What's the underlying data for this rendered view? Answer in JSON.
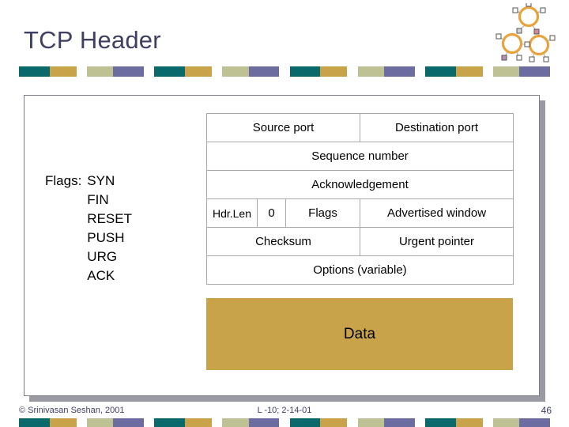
{
  "slide": {
    "title": "TCP Header",
    "title_color": "#3f3f63"
  },
  "logo": {
    "name": "molecule-logo",
    "ring_color": "#e8a33d",
    "node_color": "#ffffff"
  },
  "colorbar": {
    "colors": {
      "teal": "#0a696b",
      "gold": "#c9a34a",
      "sage": "#bdc193",
      "purple": "#6c6ca0"
    }
  },
  "flags": {
    "label": "Flags:",
    "items": [
      "SYN",
      "FIN",
      "RESET",
      "PUSH",
      "URG",
      "ACK"
    ]
  },
  "tcp_header": {
    "rows": [
      {
        "cells": [
          {
            "text": "Source port",
            "colspan": 3
          },
          {
            "text": "Destination port",
            "colspan": 3
          }
        ]
      },
      {
        "cells": [
          {
            "text": "Sequence number",
            "colspan": 6
          }
        ]
      },
      {
        "cells": [
          {
            "text": "Acknowledgement",
            "colspan": 6
          }
        ]
      },
      {
        "cells": [
          {
            "text": "Hdr.Len",
            "colspan": 1
          },
          {
            "text": "0",
            "colspan": 1
          },
          {
            "text": "Flags",
            "colspan": 1
          },
          {
            "text": "Advertised window",
            "colspan": 3
          }
        ]
      },
      {
        "cells": [
          {
            "text": "Checksum",
            "colspan": 3
          },
          {
            "text": "Urgent pointer",
            "colspan": 3
          }
        ]
      },
      {
        "cells": [
          {
            "text": "Options (variable)",
            "colspan": 6
          }
        ]
      }
    ]
  },
  "data_block": {
    "label": "Data",
    "fill_color": "#c9a34a"
  },
  "footer": {
    "copyright": "© Srinivasan Seshan, 2001",
    "lecture": "L -10; 2-14-01",
    "page_number": "46"
  }
}
